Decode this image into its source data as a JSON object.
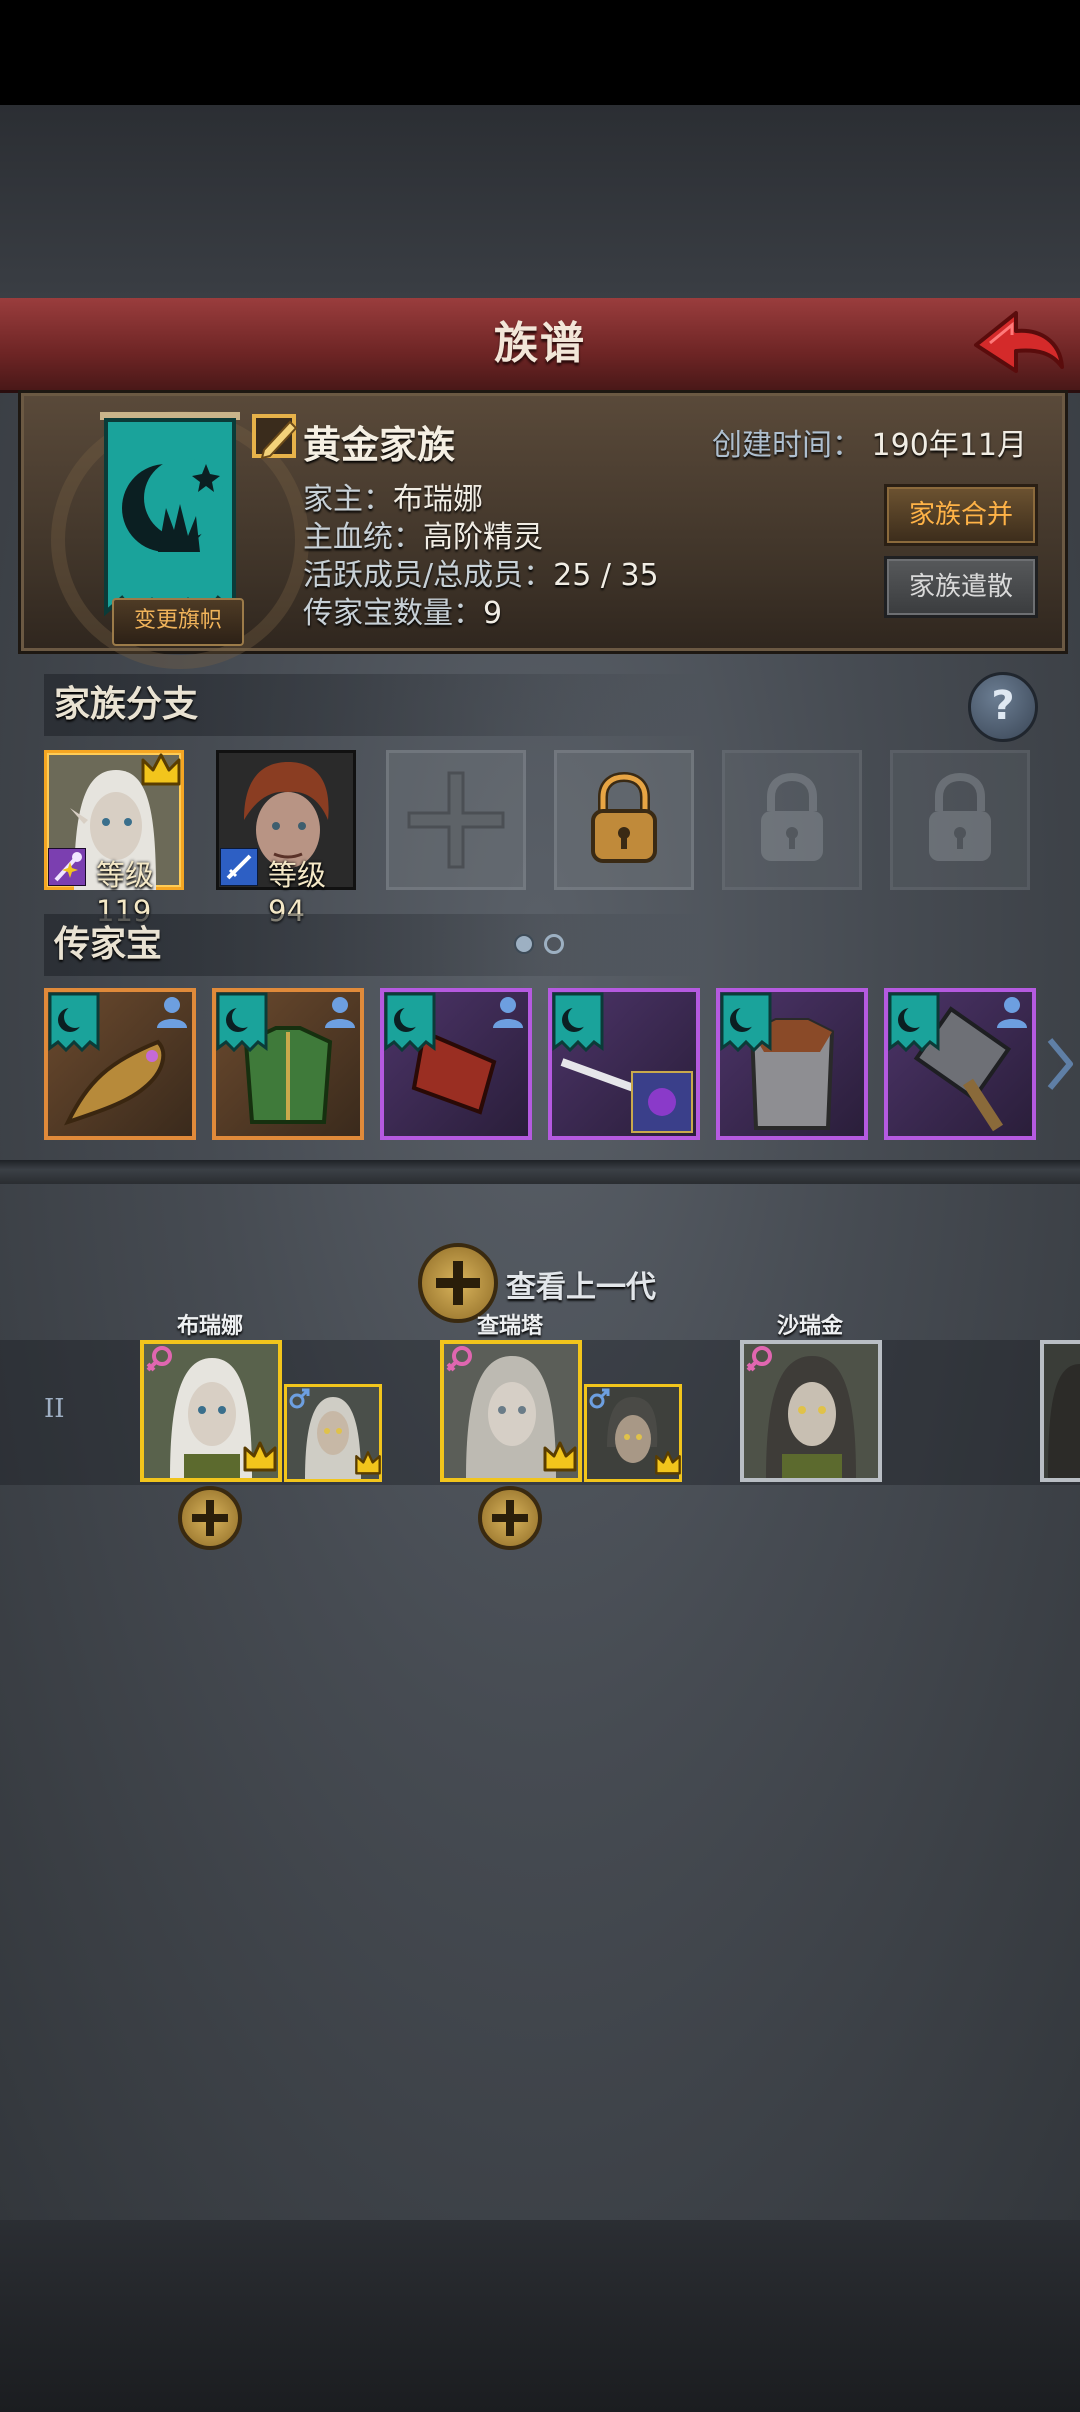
{
  "header": {
    "title": "族谱"
  },
  "family": {
    "name": "黄金家族",
    "change_banner_label": "变更旗帜",
    "head_label": "家主：",
    "head_value": "布瑞娜",
    "bloodline_label": "主血统：",
    "bloodline_value": "高阶精灵",
    "members_label": "活跃成员/总成员：",
    "members_value": "25 / 35",
    "heirloom_count_label": "传家宝数量：",
    "heirloom_count_value": "9",
    "created_label": "创建时间：",
    "created_value": "190年11月",
    "merge_button": "家族合并",
    "dissolve_button": "家族遣散"
  },
  "branches": {
    "title": "家族分支",
    "slots": [
      {
        "state": "member",
        "level_text": "等级119",
        "leader": true
      },
      {
        "state": "member",
        "level_text": "等级94",
        "leader": false
      },
      {
        "state": "empty"
      },
      {
        "state": "unlockable"
      },
      {
        "state": "locked"
      },
      {
        "state": "locked"
      }
    ]
  },
  "heirlooms": {
    "title": "传家宝",
    "pages": 2,
    "current_page": 1,
    "items": [
      {
        "rarity": "orange",
        "icon": "golden-dragon-staff-icon",
        "equipped": true
      },
      {
        "rarity": "orange",
        "icon": "green-elven-armor-icon",
        "equipped": true
      },
      {
        "rarity": "purple",
        "icon": "red-bracer-icon",
        "equipped": true
      },
      {
        "rarity": "purple",
        "icon": "crossed-sword-icon",
        "equipped": false
      },
      {
        "rarity": "purple",
        "icon": "leather-chain-armor-icon",
        "equipped": false
      },
      {
        "rarity": "purple",
        "icon": "war-hammer-icon",
        "equipped": true
      }
    ]
  },
  "tree": {
    "view_previous_label": "查看上一代",
    "generation_label": "II",
    "members": [
      {
        "name": "布瑞娜",
        "gender": "female",
        "frame": "gold",
        "has_spouse": true
      },
      {
        "name": "查瑞塔",
        "gender": "female",
        "frame": "gold",
        "has_spouse": true
      },
      {
        "name": "沙瑞金",
        "gender": "female",
        "frame": "grey",
        "has_spouse": false
      }
    ]
  },
  "colors": {
    "title_bar": "#7e2d2d",
    "gold_frame": "#f2c51c",
    "orange_rarity": "#e08a3a",
    "purple_rarity": "#b55ae0",
    "banner_teal": "#1aa39b",
    "merge_text": "#ffb347"
  }
}
